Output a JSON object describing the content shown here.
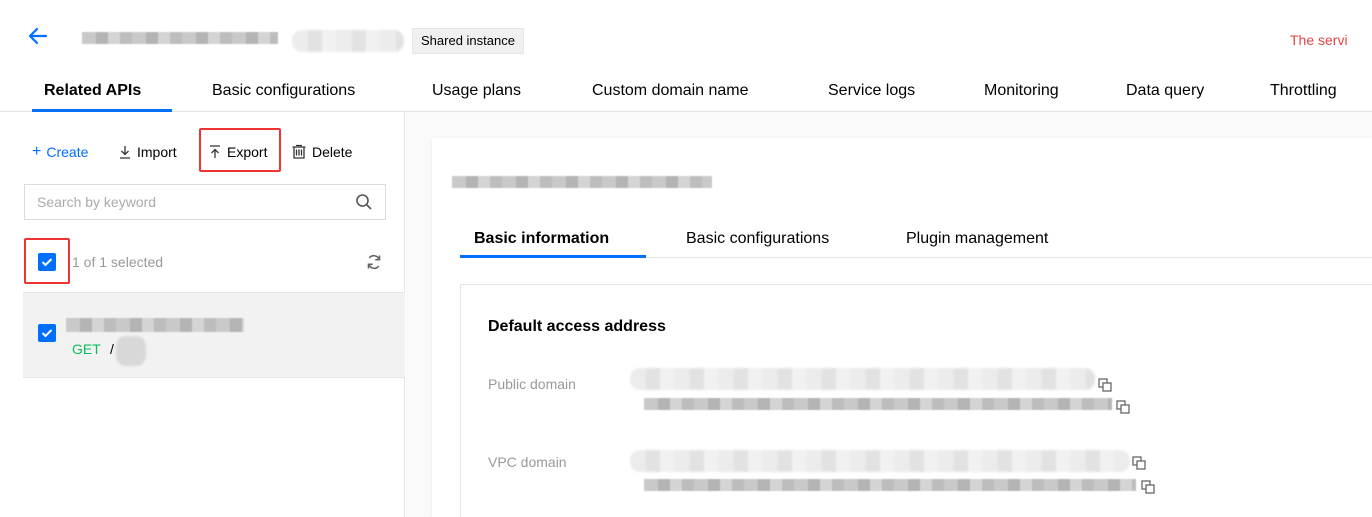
{
  "header": {
    "instance_badge": "Shared instance",
    "warning_text": "The servi"
  },
  "main_tabs": [
    {
      "label": "Related APIs",
      "active": true
    },
    {
      "label": "Basic configurations"
    },
    {
      "label": "Usage plans"
    },
    {
      "label": "Custom domain name"
    },
    {
      "label": "Service logs"
    },
    {
      "label": "Monitoring"
    },
    {
      "label": "Data query"
    },
    {
      "label": "Throttling"
    }
  ],
  "toolbar": {
    "create_label": "Create",
    "import_label": "Import",
    "export_label": "Export",
    "delete_label": "Delete"
  },
  "search": {
    "placeholder": "Search by keyword"
  },
  "selection": {
    "text": "1 of 1 selected"
  },
  "api_list": [
    {
      "method": "GET",
      "path": "/"
    }
  ],
  "detail": {
    "sub_tabs": [
      {
        "label": "Basic information",
        "active": true
      },
      {
        "label": "Basic configurations"
      },
      {
        "label": "Plugin management"
      }
    ],
    "section_title": "Default access address",
    "public_domain_label": "Public domain",
    "vpc_domain_label": "VPC domain"
  },
  "colors": {
    "accent": "#006eff",
    "highlight": "#ee3333",
    "get_method": "#0abf5b",
    "warning": "#e54545"
  },
  "icons": [
    "back-arrow-icon",
    "plus-icon",
    "import-icon",
    "export-icon",
    "delete-icon",
    "search-icon",
    "check-icon",
    "refresh-icon",
    "copy-icon"
  ]
}
